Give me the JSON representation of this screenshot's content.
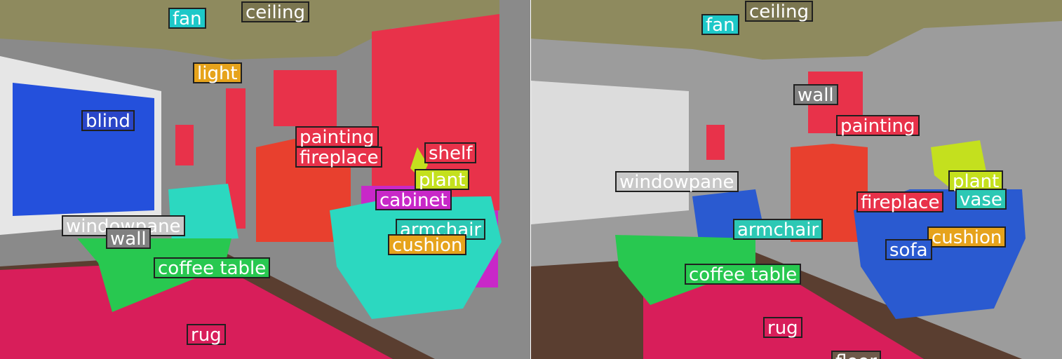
{
  "left_panel": {
    "labels": [
      {
        "text": "fan",
        "color": "#1ec8c8"
      },
      {
        "text": "ceiling",
        "color": "#7b7650"
      },
      {
        "text": "light",
        "color": "#e6a31c"
      },
      {
        "text": "blind",
        "color": "#2a46c8"
      },
      {
        "text": "painting",
        "color": "#e8324a"
      },
      {
        "text": "fireplace",
        "color": "#e8324a"
      },
      {
        "text": "shelf",
        "color": "#e8324a"
      },
      {
        "text": "plant",
        "color": "#c4e01e"
      },
      {
        "text": "cabinet",
        "color": "#c828c8"
      },
      {
        "text": "armchair",
        "color": "#2cc8b4"
      },
      {
        "text": "cushion",
        "color": "#e6a31c"
      },
      {
        "text": "windowpane",
        "color": "#c8c8c8"
      },
      {
        "text": "wall",
        "color": "#808080"
      },
      {
        "text": "coffee table",
        "color": "#28c850"
      },
      {
        "text": "rug",
        "color": "#d81e5a"
      }
    ]
  },
  "right_panel": {
    "labels": [
      {
        "text": "fan",
        "color": "#1ec8c8"
      },
      {
        "text": "ceiling",
        "color": "#7b7650"
      },
      {
        "text": "wall",
        "color": "#808080"
      },
      {
        "text": "painting",
        "color": "#e8324a"
      },
      {
        "text": "windowpane",
        "color": "#c8c8c8"
      },
      {
        "text": "plant",
        "color": "#c4e01e"
      },
      {
        "text": "vase",
        "color": "#2cc8b4"
      },
      {
        "text": "fireplace",
        "color": "#e8324a"
      },
      {
        "text": "armchair",
        "color": "#2cc8b4"
      },
      {
        "text": "cushion",
        "color": "#e6a31c"
      },
      {
        "text": "sofa",
        "color": "#2a5ad0"
      },
      {
        "text": "coffee table",
        "color": "#28c850"
      },
      {
        "text": "rug",
        "color": "#d81e5a"
      },
      {
        "text": "floor",
        "color": "#6e5a4a"
      }
    ]
  }
}
